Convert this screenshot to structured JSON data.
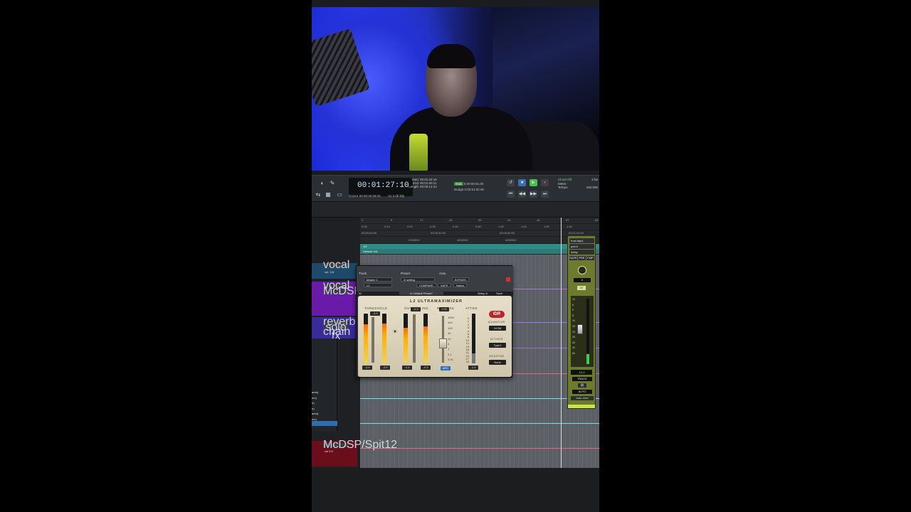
{
  "toolbar": {
    "main_counter": "00:01:27:10",
    "selection": [
      {
        "key": "Start",
        "value": "00:01:42:16"
      },
      {
        "key": "End",
        "value": "00:01:50:11"
      },
      {
        "key": "Length",
        "value": "00:00:12:24"
      }
    ],
    "cursor_label": "Cursor",
    "cursor_value": "00:00:46:28:25",
    "cursor_db": "-11.3 db",
    "dly_label": "Dly",
    "grid_label": "Grid",
    "grid_value": "0:00:00:01.00",
    "nudge_label": "Nudge",
    "nudge_value": "0:00:01:00.00",
    "tempo_lines": [
      "Cloud Off",
      "Meter",
      "Tempo"
    ],
    "tempo_values": [
      "2 ba",
      "",
      "150.000"
    ]
  },
  "rulers": {
    "bars": [
      "1",
      "9",
      "17",
      "25",
      "33",
      "41",
      "49",
      "57",
      "65"
    ],
    "mins": [
      "0:00",
      "0:10",
      "0:20",
      "0:30",
      "0:40",
      "0:50",
      "1:00",
      "1:10",
      "1:20",
      "1:30"
    ],
    "timecode": [
      "00:00:00:00",
      "00:00:20:00",
      "00:00:40:00",
      "00:01:00:00"
    ],
    "samples": [
      "2000000",
      "4000000",
      "6000000"
    ],
    "marker_label": "1/4",
    "default_label": "Default: 4/4"
  },
  "tracks": [
    {
      "name": "vocal",
      "sub": "vol -3.8",
      "color": "#6a1aa8"
    },
    {
      "name": "vocal",
      "sub": "McDSP/Spit12",
      "color": "#7a1aa0"
    },
    {
      "name": "reverb",
      "sub": "vol 0.0",
      "color": "#3a2a9a"
    },
    {
      "name": "solo chain fx",
      "sub": "vol 0.0",
      "color": "#4a1a8a"
    },
    {
      "name": "McDSP/Spit12",
      "sub": "vol 0.0",
      "color": "#8a1020"
    }
  ],
  "side_list": [
    "area)",
    "mo)",
    "o)",
    "o)",
    "area)",
    "mo)"
  ],
  "plugin": {
    "track_label": "Track",
    "preset_label": "Preset",
    "auto_label": "Auto",
    "track_value": "Master 1",
    "track_sub": "L2",
    "preset_value": "l2 setting",
    "compare": "COMPARE",
    "safe": "SAFE",
    "bypass": "BYPASS",
    "native": "Native",
    "preset_bar": "A: Default Preset*",
    "setup": "Setup A",
    "save": "Save",
    "title": "L2 ULTRAMAXIMIZER",
    "threshold_label": "THRESHOLD",
    "ceiling_label": "OUT CEILING",
    "release_label": "RELEASE",
    "atten_label": "ATTEN",
    "threshold_value": "-3.9",
    "ceiling_value": "-0.3",
    "release_value": "1.00",
    "arc_label": "ARC",
    "link_label": "LINK",
    "release_scale": [
      "1000",
      "400",
      "100",
      "40",
      "10",
      "4",
      "1",
      "0.1",
      "0.01"
    ],
    "atten_scale": [
      "0",
      "1",
      "2",
      "3",
      "4",
      "6",
      "8",
      "10",
      "12",
      "15",
      "18",
      "21",
      "24",
      "27",
      "30"
    ],
    "meter_bottoms": [
      "-3.9",
      "-3.9",
      "-0.3",
      "-0.3"
    ],
    "atten_bottom": "-1.9",
    "logo": "IDR",
    "quantize_label": "QUANTIZE",
    "quantize_value": "24 Bit",
    "dither_label": "DITHER",
    "dither_value": "Type1",
    "shaping_label": "SHAPING",
    "shaping_value": "None",
    "levels": {
      "thr_l": 0.78,
      "thr_r": 0.8,
      "ceil_l": 0.72,
      "ceil_r": 0.74,
      "atten": 0.2
    }
  },
  "strip": {
    "inserts": [
      "frost.dap1",
      "pad.b",
      "delay"
    ],
    "buttons": [
      "SAFE",
      "PRE",
      "FMP"
    ],
    "pan_value": "0",
    "mute": "M",
    "fader_scale": [
      "12",
      "6",
      "0",
      "5",
      "10",
      "15",
      "20",
      "25",
      "30",
      "40",
      "60"
    ],
    "fader_value": "-13.4",
    "track_btn": "TRACK",
    "auto_btn": "AUTO",
    "auto_mode": "auto read",
    "meter_level": 0.15
  }
}
